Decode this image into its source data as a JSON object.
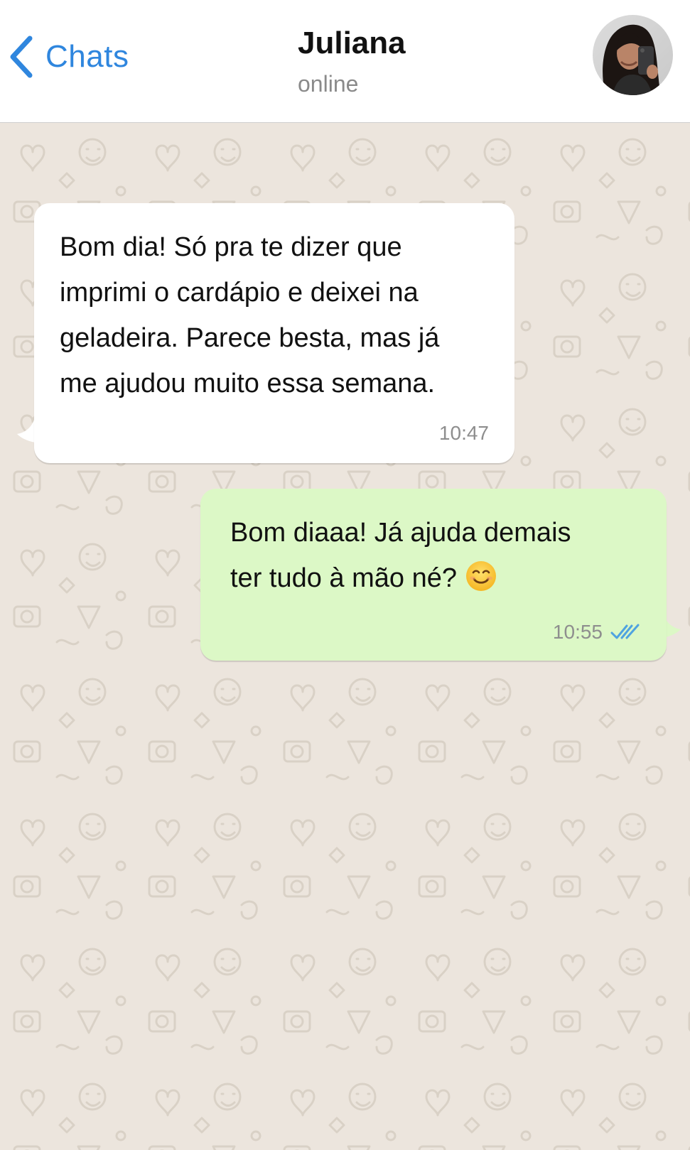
{
  "header": {
    "back_label": "Chats",
    "contact_name": "Juliana",
    "contact_status": "online"
  },
  "messages": [
    {
      "direction": "incoming",
      "text": "Bom dia! Só pra te dizer que\nimprimi o cardápio e deixei na\ngeladeira. Parece besta, mas já\nme ajudou muito essa semana.",
      "time": "10:47"
    },
    {
      "direction": "outgoing",
      "text_line1": "Bom diaaa! Já ajuda demais",
      "text_line2": "ter tudo à mão né?",
      "emoji": "smiling-face-icon",
      "time": "10:55",
      "status": "read-double-check-icon"
    }
  ],
  "colors": {
    "accent": "#2f86de",
    "incoming_bubble": "#ffffff",
    "outgoing_bubble": "#dcf8c6",
    "background": "#ece5dd",
    "read_tick": "#4fa3e0"
  }
}
